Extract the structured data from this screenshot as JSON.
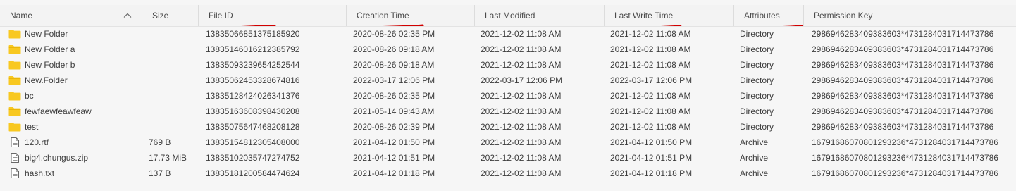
{
  "colors": {
    "folder": "#f8c820",
    "underline": "#d10000",
    "header_bg": "#f3f3f3",
    "row_bg": "#f6f6f6"
  },
  "columns": [
    {
      "key": "name",
      "label": "Name",
      "underlined": false,
      "sorted": "ascending"
    },
    {
      "key": "size",
      "label": "Size",
      "underlined": false
    },
    {
      "key": "file_id",
      "label": "File ID",
      "underlined": true
    },
    {
      "key": "creation_time",
      "label": "Creation Time",
      "underlined": true
    },
    {
      "key": "last_modified",
      "label": "Last Modified",
      "underlined": false
    },
    {
      "key": "last_write_time",
      "label": "Last Write Time",
      "underlined": true
    },
    {
      "key": "attributes",
      "label": "Attributes",
      "underlined": true
    },
    {
      "key": "permission_key",
      "label": "Permission Key",
      "underlined": false
    }
  ],
  "rows": [
    {
      "icon": "folder-icon",
      "name": "New Folder",
      "size": "",
      "file_id": "13835066851375185920",
      "creation_time": "2020-08-26 02:35 PM",
      "last_modified": "2021-12-02 11:08 AM",
      "last_write_time": "2021-12-02 11:08 AM",
      "attributes": "Directory",
      "permission_key": "2986946283409383603*4731284031714473786"
    },
    {
      "icon": "folder-icon",
      "name": "New Folder a",
      "size": "",
      "file_id": "13835146016212385792",
      "creation_time": "2020-08-26 09:18 AM",
      "last_modified": "2021-12-02 11:08 AM",
      "last_write_time": "2021-12-02 11:08 AM",
      "attributes": "Directory",
      "permission_key": "2986946283409383603*4731284031714473786"
    },
    {
      "icon": "folder-icon",
      "name": "New Folder b",
      "size": "",
      "file_id": "13835093239654252544",
      "creation_time": "2020-08-26 09:18 AM",
      "last_modified": "2021-12-02 11:08 AM",
      "last_write_time": "2021-12-02 11:08 AM",
      "attributes": "Directory",
      "permission_key": "2986946283409383603*4731284031714473786"
    },
    {
      "icon": "folder-icon",
      "name": "New.Folder",
      "size": "",
      "file_id": "13835062453328674816",
      "creation_time": "2022-03-17 12:06 PM",
      "last_modified": "2022-03-17 12:06 PM",
      "last_write_time": "2022-03-17 12:06 PM",
      "attributes": "Directory",
      "permission_key": "2986946283409383603*4731284031714473786"
    },
    {
      "icon": "folder-icon",
      "name": "bc",
      "size": "",
      "file_id": "13835128424026341376",
      "creation_time": "2020-08-26 02:35 PM",
      "last_modified": "2021-12-02 11:08 AM",
      "last_write_time": "2021-12-02 11:08 AM",
      "attributes": "Directory",
      "permission_key": "2986946283409383603*4731284031714473786"
    },
    {
      "icon": "folder-icon",
      "name": "fewfaewfeawfeaw",
      "size": "",
      "file_id": "13835163608398430208",
      "creation_time": "2021-05-14 09:43 AM",
      "last_modified": "2021-12-02 11:08 AM",
      "last_write_time": "2021-12-02 11:08 AM",
      "attributes": "Directory",
      "permission_key": "2986946283409383603*4731284031714473786"
    },
    {
      "icon": "folder-icon",
      "name": "test",
      "size": "",
      "file_id": "13835075647468208128",
      "creation_time": "2020-08-26 02:39 PM",
      "last_modified": "2021-12-02 11:08 AM",
      "last_write_time": "2021-12-02 11:08 AM",
      "attributes": "Directory",
      "permission_key": "2986946283409383603*4731284031714473786"
    },
    {
      "icon": "file-icon",
      "name": "120.rtf",
      "size": "769 B",
      "file_id": "13835154812305408000",
      "creation_time": "2021-04-12 01:50 PM",
      "last_modified": "2021-12-02 11:08 AM",
      "last_write_time": "2021-04-12 01:50 PM",
      "attributes": "Archive",
      "permission_key": "16791686070801293236*4731284031714473786"
    },
    {
      "icon": "file-icon",
      "name": "big4.chungus.zip",
      "size": "17.73 MiB",
      "file_id": "13835102035747274752",
      "creation_time": "2021-04-12 01:51 PM",
      "last_modified": "2021-12-02 11:08 AM",
      "last_write_time": "2021-04-12 01:51 PM",
      "attributes": "Archive",
      "permission_key": "16791686070801293236*4731284031714473786"
    },
    {
      "icon": "file-icon",
      "name": "hash.txt",
      "size": "137 B",
      "file_id": "13835181200584474624",
      "creation_time": "2021-04-12 01:18 PM",
      "last_modified": "2021-12-02 11:08 AM",
      "last_write_time": "2021-04-12 01:18 PM",
      "attributes": "Archive",
      "permission_key": "16791686070801293236*4731284031714473786"
    }
  ]
}
